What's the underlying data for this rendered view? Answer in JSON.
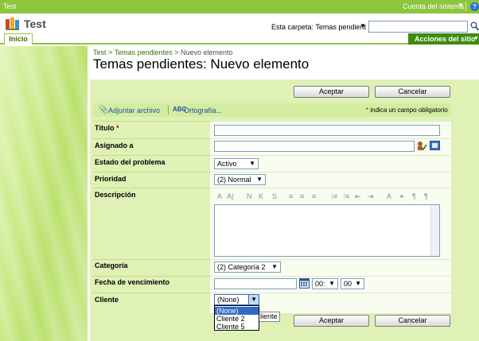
{
  "topbar": {
    "title": "Test",
    "account": "Cuenta del sistema",
    "account_arrow": "▼",
    "help": "?"
  },
  "header": {
    "site_title": "Test",
    "search_scope": "Esta carpeta: Temas pendient",
    "search_scope_arrow": "▼",
    "search_value": ""
  },
  "nav": {
    "tab_home": "Inicio",
    "site_actions": "Acciones del sitio",
    "site_actions_arrow": "▼"
  },
  "breadcrumb": {
    "root": "Test",
    "sep1": ">",
    "list": "Temas pendientes",
    "sep2": ">",
    "current": "Nuevo elemento"
  },
  "page_title": "Temas pendientes: Nuevo elemento",
  "buttons": {
    "ok": "Aceptar",
    "cancel": "Cancelar"
  },
  "toolbar": {
    "attach": "Adjuntar archivo",
    "spelling": "Ortografía...",
    "required_star": "*",
    "required_note": "indica un campo obligatorio",
    "spell_icon_text": "ABC"
  },
  "fields": {
    "titulo": {
      "label": "Título",
      "required": "*",
      "value": ""
    },
    "asignado": {
      "label": "Asignado a",
      "value": ""
    },
    "estado": {
      "label": "Estado del problema",
      "value": "Activo"
    },
    "prioridad": {
      "label": "Prioridad",
      "value": "(2) Normal"
    },
    "descripcion": {
      "label": "Descripción",
      "value": ""
    },
    "categoria": {
      "label": "Categoría",
      "value": "(2) Categoría 2"
    },
    "fecha": {
      "label": "Fecha de vencimiento",
      "date": "",
      "hour": "00:",
      "minute": "00"
    },
    "cliente": {
      "label": "Cliente",
      "value": "(None)",
      "options": [
        "(None)",
        "Cliente 2",
        "Cliente 5"
      ],
      "tooltip": "liente"
    }
  },
  "rte_buttons": [
    "A",
    "A|",
    "N",
    "K",
    "S",
    "≡",
    "≡",
    "≡",
    "⁝≡",
    "⁝≡",
    "⇤",
    "⇥",
    "A",
    "⚭",
    "¶",
    "¶"
  ],
  "colors": {
    "topbar": "#8cc63f",
    "accent_dark": "#3e8b0f",
    "form_bg": "#dff1b5",
    "link": "#1f4fa3",
    "required": "#cc0000",
    "selected_option": "#316ac5"
  }
}
